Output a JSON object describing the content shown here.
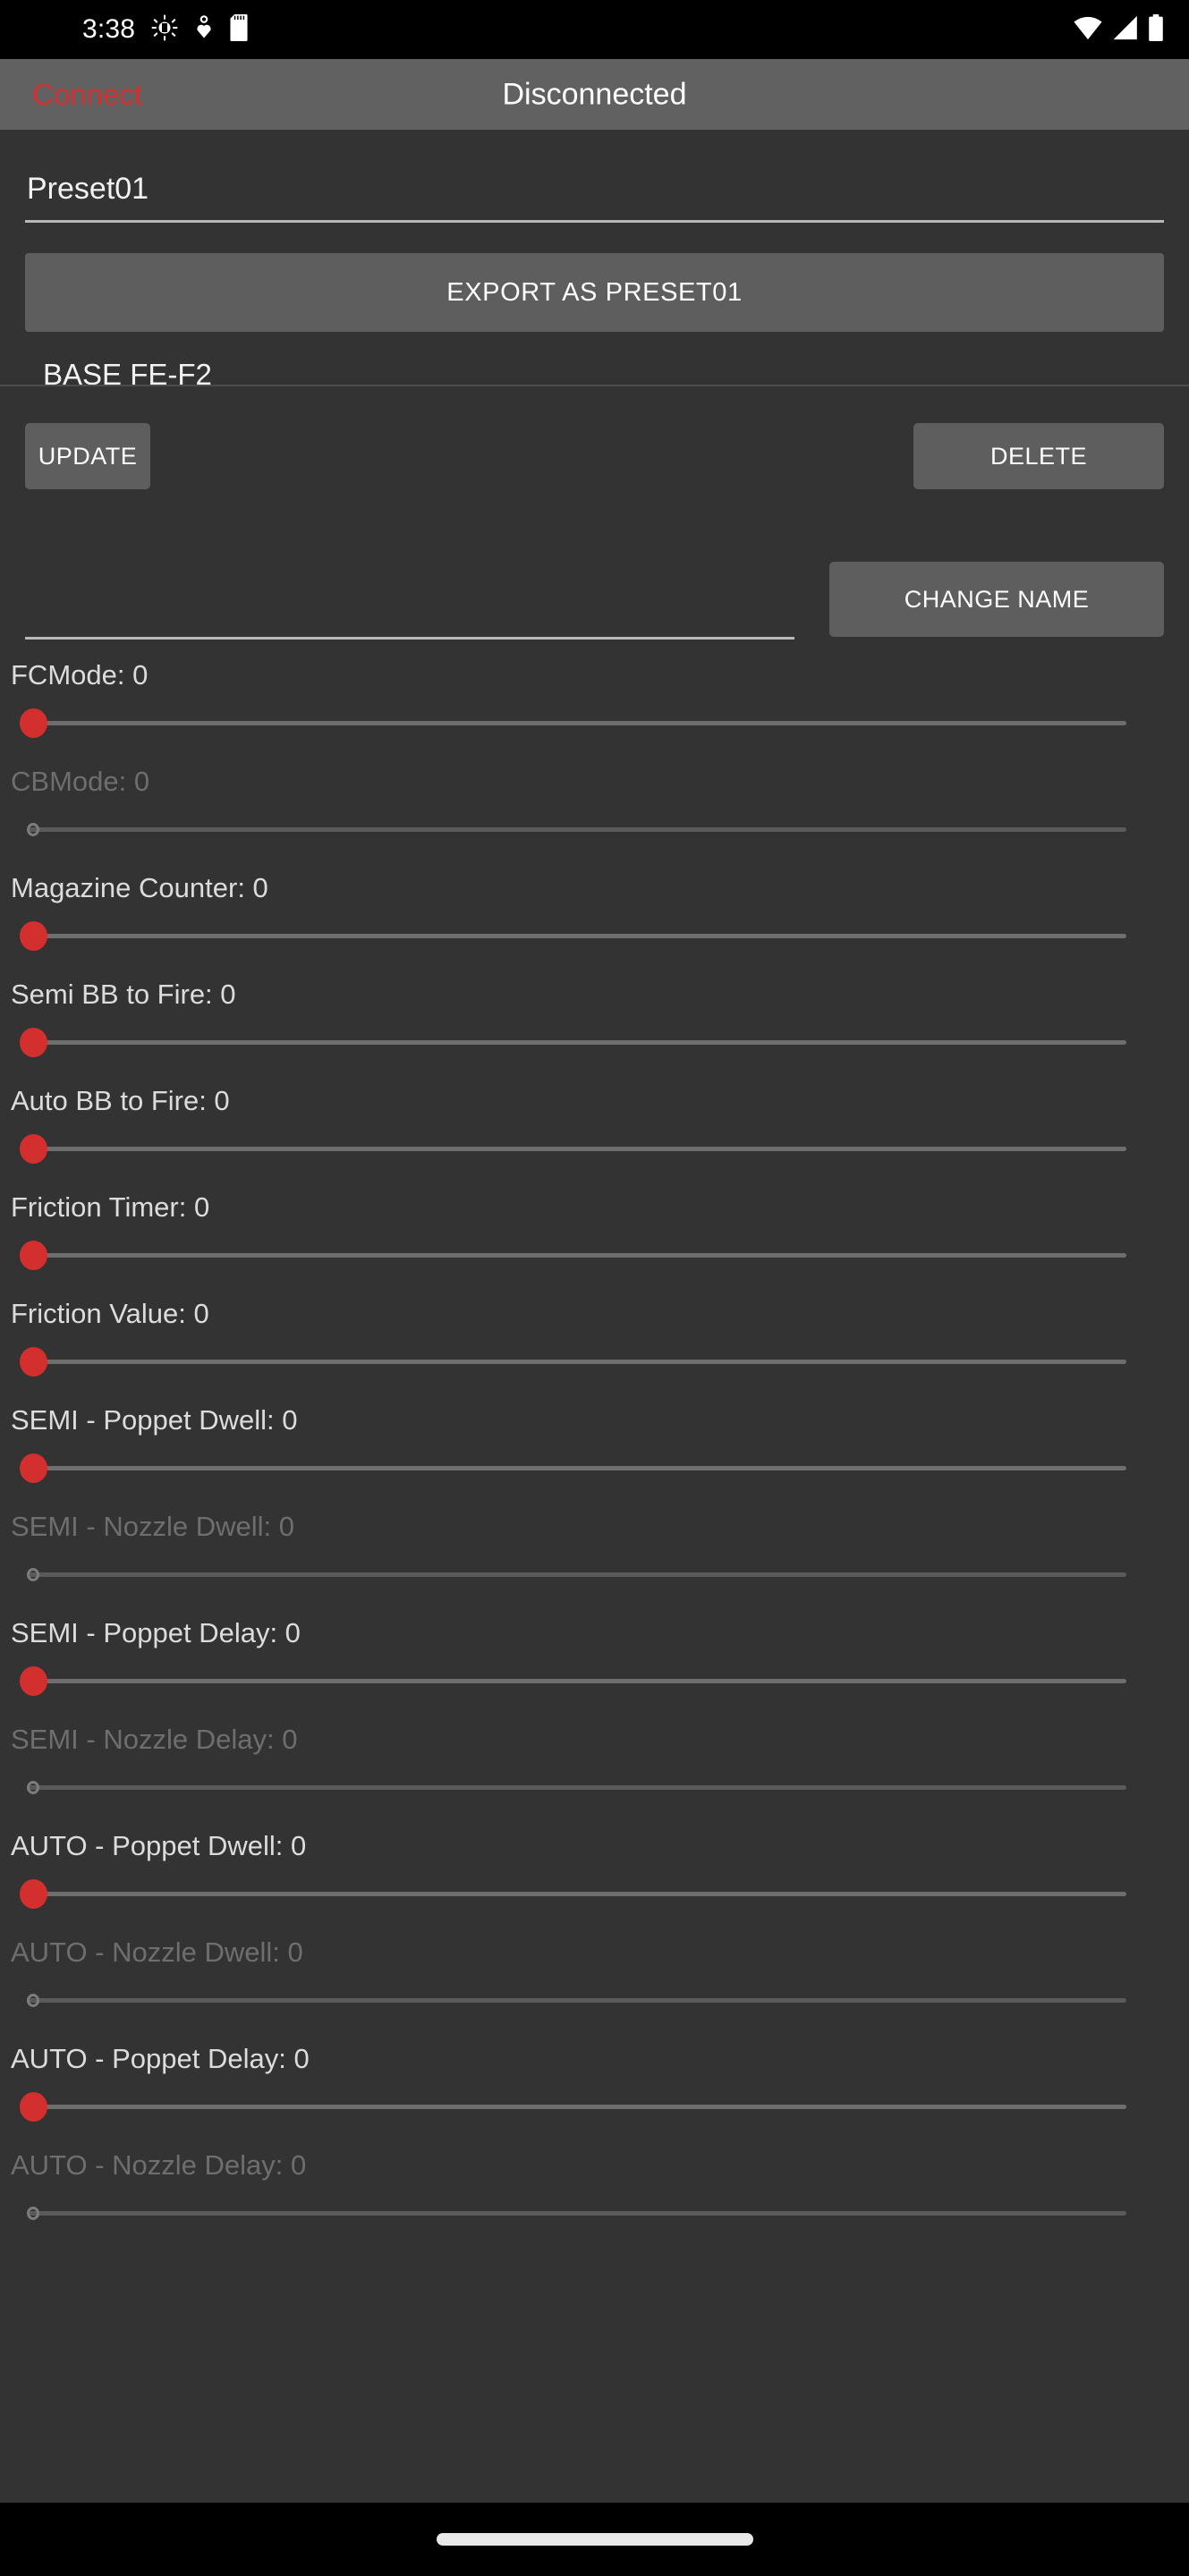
{
  "status_bar": {
    "time": "3:38",
    "left_icons": [
      "android-debug-icon",
      "heart-rate-icon",
      "sd-card-icon"
    ],
    "right_icons": [
      "wifi-icon",
      "cellular-signal-icon",
      "battery-icon"
    ]
  },
  "app_bar": {
    "connect_label": "Connect",
    "connect_color": "#d32f2f",
    "title": "Disconnected"
  },
  "preset": {
    "name_value": "Preset01",
    "name_placeholder": "",
    "export_label": "EXPORT AS PRESET01",
    "base_label": "BASE FE-F2",
    "update_label": "UPDATE",
    "delete_label": "DELETE",
    "change_name_label": "CHANGE NAME",
    "rename_value": "",
    "rename_placeholder": ""
  },
  "accent_colors": {
    "thumb_active": "#d32f2f",
    "thumb_disabled_border": "#7c7c7c",
    "track": "#6e6e6e",
    "button": "#5e5e5e",
    "appbar": "#616161",
    "background": "#333333"
  },
  "sliders": [
    {
      "label": "FCMode: 0",
      "value": 0,
      "enabled": true
    },
    {
      "label": "CBMode: 0",
      "value": 0,
      "enabled": false
    },
    {
      "label": "Magazine Counter: 0",
      "value": 0,
      "enabled": true
    },
    {
      "label": "Semi BB to Fire: 0",
      "value": 0,
      "enabled": true
    },
    {
      "label": "Auto BB to Fire: 0",
      "value": 0,
      "enabled": true
    },
    {
      "label": "Friction Timer: 0",
      "value": 0,
      "enabled": true
    },
    {
      "label": "Friction Value: 0",
      "value": 0,
      "enabled": true
    },
    {
      "label": "SEMI - Poppet Dwell: 0",
      "value": 0,
      "enabled": true
    },
    {
      "label": "SEMI - Nozzle Dwell: 0",
      "value": 0,
      "enabled": false
    },
    {
      "label": "SEMI - Poppet Delay: 0",
      "value": 0,
      "enabled": true
    },
    {
      "label": "SEMI - Nozzle Delay: 0",
      "value": 0,
      "enabled": false
    },
    {
      "label": "AUTO - Poppet Dwell: 0",
      "value": 0,
      "enabled": true
    },
    {
      "label": "AUTO - Nozzle Dwell: 0",
      "value": 0,
      "enabled": false
    },
    {
      "label": "AUTO - Poppet Delay: 0",
      "value": 0,
      "enabled": true
    },
    {
      "label": "AUTO - Nozzle Delay: 0",
      "value": 0,
      "enabled": false
    }
  ]
}
